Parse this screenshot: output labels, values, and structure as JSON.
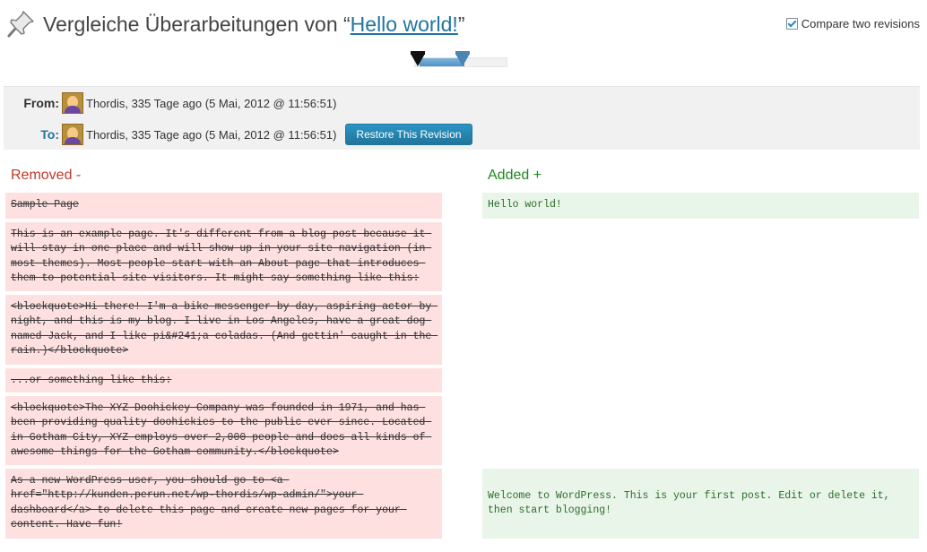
{
  "header": {
    "title_prefix": "Vergleiche Überarbeitungen von “",
    "title_link": "Hello world!",
    "title_suffix": "”",
    "compare_label": "Compare two revisions"
  },
  "meta": {
    "from_label": "From:",
    "to_label": "To:",
    "from_text": "Thordis, 335 Tage ago (5 Mai, 2012 @ 11:56:51)",
    "to_text": "Thordis, 335 Tage ago (5 Mai, 2012 @ 11:56:51)",
    "restore_button": "Restore This Revision"
  },
  "diff": {
    "removed_heading": "Removed -",
    "added_heading": "Added +",
    "removed": [
      "Sample Page",
      "This is an example page. It's different from a blog post because it will stay in one place and will show up in your site navigation (in most themes). Most people start with an About page that introduces them to potential site visitors. It might say something like this:",
      "<blockquote>Hi there! I'm a bike messenger by day, aspiring actor by night, and this is my blog. I live in Los Angeles, have a great dog named Jack, and I like pi&#241;a coladas. (And gettin' caught in the rain.)</blockquote>",
      "...or something like this:",
      "<blockquote>The XYZ Doohickey Company was founded in 1971, and has been providing quality doohickies to the public ever since. Located in Gotham City, XYZ employs over 2,000 people and does all kinds of awesome things for the Gotham community.</blockquote>",
      "As a new WordPress user, you should go to <a href=\"http://kunden.perun.net/wp-thordis/wp-admin/\">your dashboard</a> to delete this page and create new pages for your content. Have fun!"
    ],
    "added": [
      "Hello world!",
      "Welcome to WordPress. This is your first post. Edit or delete it, then start blogging!"
    ]
  }
}
